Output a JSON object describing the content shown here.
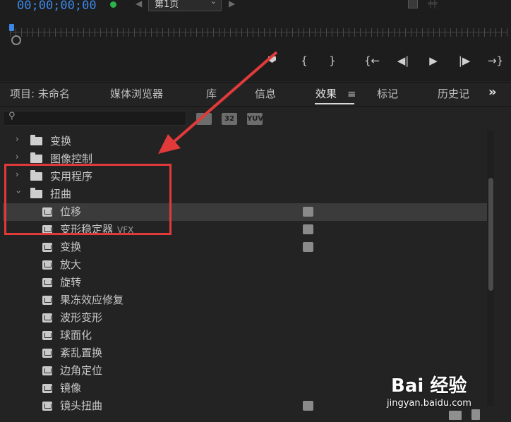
{
  "transport": {
    "timecode": "00;00;00;00",
    "page_select": "第1页",
    "buttons": [
      "{",
      "}",
      "{←",
      "◀|",
      "▶",
      "|▶",
      "→}"
    ]
  },
  "tabs": {
    "project": "项目: 未命名",
    "media_browser": "媒体浏览器",
    "library": "库",
    "info": "信息",
    "effects": "效果",
    "markers": "标记",
    "history": "历史记",
    "overflow": "»"
  },
  "filters": {
    "accelerated": "",
    "bit32": "32",
    "yuv": "YUV"
  },
  "list": {
    "rows": [
      {
        "label": "变换",
        "type": "folder",
        "expanded": false
      },
      {
        "label": "图像控制",
        "type": "folder",
        "expanded": false
      },
      {
        "label": "实用程序",
        "type": "folder",
        "expanded": false
      },
      {
        "label": "扭曲",
        "type": "folder",
        "expanded": true
      },
      {
        "label": "位移",
        "type": "effect",
        "accelerated": true,
        "selected": true
      },
      {
        "label": "变形稳定器",
        "suffix": "VFX",
        "type": "effect",
        "accelerated": true
      },
      {
        "label": "变换",
        "type": "effect",
        "accelerated": true
      },
      {
        "label": "放大",
        "type": "effect"
      },
      {
        "label": "旋转",
        "type": "effect"
      },
      {
        "label": "果冻效应修复",
        "type": "effect"
      },
      {
        "label": "波形变形",
        "type": "effect"
      },
      {
        "label": "球面化",
        "type": "effect"
      },
      {
        "label": "紊乱置换",
        "type": "effect"
      },
      {
        "label": "边角定位",
        "type": "effect"
      },
      {
        "label": "镜像",
        "type": "effect"
      },
      {
        "label": "镜头扭曲",
        "type": "effect",
        "accelerated": true
      }
    ]
  },
  "watermark": {
    "title": "Bai 经验",
    "url": "jingyan.baidu.com"
  },
  "colors": {
    "timecode": "#3c87e6",
    "highlight": "#e13a3a",
    "selected_row": "#3b3b3b"
  }
}
